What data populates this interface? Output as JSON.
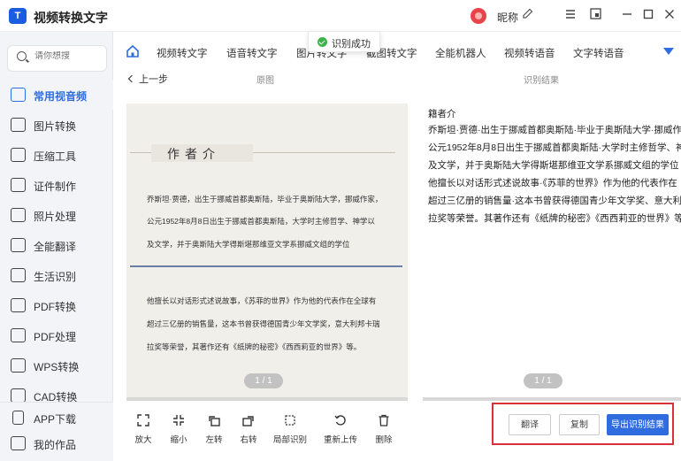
{
  "app": {
    "logo_text": "T",
    "title": "视频转换文字",
    "nickname": "昵称"
  },
  "sidebar": {
    "search_placeholder": "请你想搜",
    "items": [
      {
        "label": "常用视音频",
        "icon": "play-square-icon",
        "active": true
      },
      {
        "label": "图片转换",
        "icon": "image-icon"
      },
      {
        "label": "压缩工具",
        "icon": "zip-icon"
      },
      {
        "label": "证件制作",
        "icon": "id-card-icon"
      },
      {
        "label": "照片处理",
        "icon": "photo-icon"
      },
      {
        "label": "全能翻译",
        "icon": "translate-icon"
      },
      {
        "label": "生活识别",
        "icon": "cup-icon"
      },
      {
        "label": "PDF转换",
        "icon": "pdf-convert-icon"
      },
      {
        "label": "PDF处理",
        "icon": "pdf-process-icon"
      },
      {
        "label": "WPS转换",
        "icon": "wps-icon"
      },
      {
        "label": "CAD转换",
        "icon": "cad-icon"
      }
    ],
    "bottom_items": [
      {
        "label": "APP下载",
        "icon": "phone-icon"
      },
      {
        "label": "我的作品",
        "icon": "folder-icon"
      }
    ]
  },
  "tabs": [
    "视频转文字",
    "语音转文字",
    "图片转文字",
    "截图转文字",
    "全能机器人",
    "视频转语音",
    "文字转语音"
  ],
  "toast": {
    "text": "识别成功"
  },
  "subheader": {
    "back_label": "上一步",
    "original_label": "原图",
    "result_label": "识别结果"
  },
  "original": {
    "heading": "作者介",
    "lines": [
      "乔斯坦·贾德，出生于挪威首都奥斯陆，毕业于奥斯陆大学，挪威作家，",
      "公元1952年8月8日出生于挪威首都奥斯陆，大学时主修哲学、神学以",
      "及文学，并于奥斯陆大学得斯堪那维亚文学系挪威文组的学位",
      "他擅长以对话形式述说故事，《苏菲的世界》作为他的代表作在全球有",
      "超过三亿册的销售量，这本书曾获得德国青少年文学奖，意大利邦卡瑞",
      "拉奖等荣誉，其著作还有《纸牌的秘密》《西西莉亚的世界》等。"
    ],
    "page": "1 / 1"
  },
  "result": {
    "lines": [
      "籍者介",
      "乔斯坦·贾德·出生于挪威首都奥斯陆·毕业于奥斯陆大学·挪威作",
      "公元1952年8月8日出生于挪威首都奥斯陆·大学时主修哲学、神",
      "及文学，并于奥斯陆大学得斯堪那维亚文学系挪威文组的学位",
      "他擅长以对话形式述说故事·《苏菲的世界》作为他的代表作在",
      "超过三亿册的销售量·这本书曾获得德国青少年文学奖、意大利",
      "拉奖等荣誉。其著作还有《纸牌的秘密》《西西莉亚的世界》等"
    ],
    "page": "1 / 1"
  },
  "toolbar": [
    {
      "label": "放大",
      "icon": "expand-icon"
    },
    {
      "label": "缩小",
      "icon": "shrink-icon"
    },
    {
      "label": "左转",
      "icon": "rotate-left-icon"
    },
    {
      "label": "右转",
      "icon": "rotate-right-icon"
    },
    {
      "label": "局部识别",
      "icon": "crop-icon"
    },
    {
      "label": "重新上传",
      "icon": "reupload-icon"
    },
    {
      "label": "删除",
      "icon": "trash-icon"
    }
  ],
  "actions": {
    "translate": "翻译",
    "copy": "复制",
    "export": "导出识别结果"
  },
  "colors": {
    "accent": "#2f6ce0",
    "highlight_border": "#d9313a",
    "success": "#3bb54a"
  }
}
